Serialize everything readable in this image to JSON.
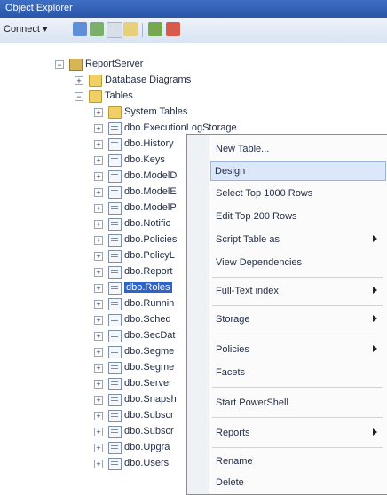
{
  "window": {
    "title": "Object Explorer"
  },
  "toolbar": {
    "connect_label": "Connect ▾"
  },
  "tree": {
    "server": "ReportServer",
    "folders": [
      "Database Diagrams",
      "Tables"
    ],
    "system_tables": "System Tables",
    "tables": [
      "dbo.ExecutionLogStorage",
      "dbo.History",
      "dbo.Keys",
      "dbo.ModelD",
      "dbo.ModelE",
      "dbo.ModelP",
      "dbo.Notific",
      "dbo.Policies",
      "dbo.PolicyL",
      "dbo.Report",
      "dbo.Roles",
      "dbo.Runnin",
      "dbo.Sched",
      "dbo.SecDat",
      "dbo.Segme",
      "dbo.Segme",
      "dbo.Server",
      "dbo.Snapsh",
      "dbo.Subscr",
      "dbo.Subscr",
      "dbo.Upgra",
      "dbo.Users"
    ],
    "selected": "dbo.Roles"
  },
  "context_menu": {
    "items": [
      {
        "label": "New Table...",
        "has_submenu": false
      },
      {
        "label": "Design",
        "has_submenu": false,
        "highlighted": true
      },
      {
        "label": "Select Top 1000 Rows",
        "has_submenu": false
      },
      {
        "label": "Edit Top 200 Rows",
        "has_submenu": false
      },
      {
        "label": "Script Table as",
        "has_submenu": true
      },
      {
        "label": "View Dependencies",
        "has_submenu": false
      },
      {
        "label": "Full-Text index",
        "has_submenu": true
      },
      {
        "label": "Storage",
        "has_submenu": true
      },
      {
        "label": "Policies",
        "has_submenu": true
      },
      {
        "label": "Facets",
        "has_submenu": false
      },
      {
        "label": "Start PowerShell",
        "has_submenu": false
      },
      {
        "label": "Reports",
        "has_submenu": true
      },
      {
        "label": "Rename",
        "has_submenu": false
      },
      {
        "label": "Delete",
        "has_submenu": false
      }
    ]
  }
}
